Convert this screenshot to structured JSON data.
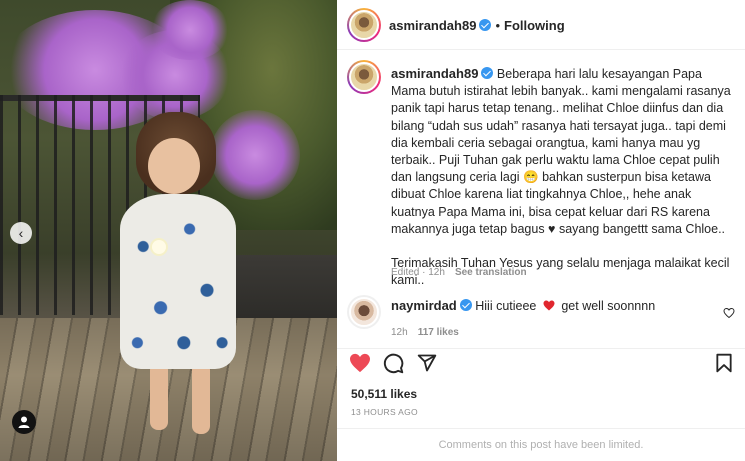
{
  "post_image": {
    "alt": "Toddler in floral sleeveless dress standing on a wooden deck"
  },
  "header": {
    "username": "asmirandah89",
    "separator": "•",
    "follow_status": "Following"
  },
  "caption": {
    "username": "asmirandah89",
    "text": "Beberapa hari lalu kesayangan Papa Mama butuh istirahat lebih banyak.. kami mengalami rasanya panik tapi harus tetap tenang.. melihat Chloe diinfus dan dia bilang “udah sus udah” rasanya hati tersayat juga.. tapi demi dia kembali ceria sebagai orangtua, kami hanya mau yg terbaik.. Puji Tuhan gak perlu waktu lama Chloe cepat pulih dan langsung ceria lagi 😁 bahkan susterpun bisa ketawa dibuat Chloe karena liat tingkahnya Chloe,, hehe anak kuatnya Papa Mama ini, bisa cepat keluar dari RS karena makannya juga tetap bagus ♥ sayang bangettt sama Chloe..\n\nTerimakasih Tuhan Yesus yang selalu menjaga malaikat kecil kami..",
    "edited": "Edited · 12h",
    "see_translation": "See translation"
  },
  "comments": [
    {
      "username": "naymirdad",
      "text_before": "Hiii cutieee",
      "text_after": "get well soonnnn",
      "time": "12h",
      "likes": "117 likes"
    }
  ],
  "icons": {
    "like": "heart-icon",
    "comment": "comment-icon",
    "share": "share-icon",
    "save": "bookmark-icon",
    "comment_like": "heart-outline-icon",
    "carousel_prev": "chevron-left-icon",
    "tag": "user-tag-icon"
  },
  "colors": {
    "like_red": "#ed4956",
    "verified_blue": "#3897f0",
    "muted": "#8e8e8e"
  },
  "stats": {
    "likes": "50,511 likes",
    "time_ago": "13 HOURS AGO"
  },
  "footer": {
    "comments_limited": "Comments on this post have been limited."
  }
}
